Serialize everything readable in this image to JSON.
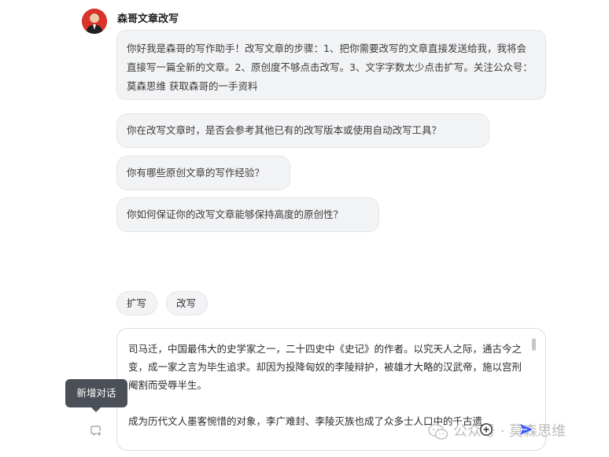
{
  "bot": {
    "name": "森哥文章改写"
  },
  "messages": {
    "greeting": "你好我是森哥的写作助手！改写文章的步骤：1、把你需要改写的文章直接发送给我，我将会直接写一篇全新的文章。2、原创度不够点击改写。3、文字字数太少点击扩写。关注公众号：莫森思维 获取森哥的一手资料"
  },
  "suggestions": [
    "你在改写文章时，是否会参考其他已有的改写版本或使用自动改写工具？",
    "你有哪些原创文章的写作经验？",
    "你如何保证你的改写文章能够保持高度的原创性？"
  ],
  "actions": {
    "expand": "扩写",
    "rewrite": "改写"
  },
  "input": {
    "value": "司马迁，中国最伟大的史学家之一，二十四史中《史记》的作者。以究天人之际，通古今之变，成一家之言为毕生追求。却因为投降匈奴的李陵辩护，被雄才大略的汉武帝，施以宫刑阉割而受辱半生。\n\n成为历代文人墨客惋惜的对象，李广难封、李陵灭族也成了众多士人口中的千古遗"
  },
  "tooltip": {
    "new_chat": "新增对话"
  },
  "watermark": {
    "text": "公众号 · 莫森思维"
  },
  "colors": {
    "accent_blue": "#3d5afe",
    "bubble_bg": "#f2f3f5",
    "tooltip_bg": "#4b4f57"
  },
  "icons": {
    "new_chat": "new-chat-icon",
    "plus": "plus-circle-icon",
    "send": "send-icon",
    "wechat": "wechat-icon"
  }
}
